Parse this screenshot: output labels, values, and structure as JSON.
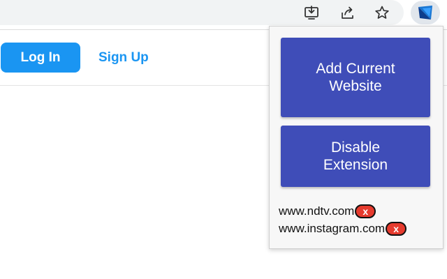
{
  "toolbar": {
    "icons": [
      "install-app-icon",
      "share-icon",
      "bookmark-star-icon",
      "extension-logo-icon"
    ]
  },
  "site_nav": {
    "login_label": "Log In",
    "signup_label": "Sign Up"
  },
  "popup": {
    "add_label": "Add Current Website",
    "disable_label": "Disable Extension",
    "sites": [
      {
        "domain": "www.ndtv.com",
        "remove": "x"
      },
      {
        "domain": "www.instagram.com",
        "remove": "x"
      }
    ]
  },
  "colors": {
    "accent_blue": "#1a95f2",
    "popup_button": "#3f4db8",
    "remove_red": "#e63b2e"
  }
}
